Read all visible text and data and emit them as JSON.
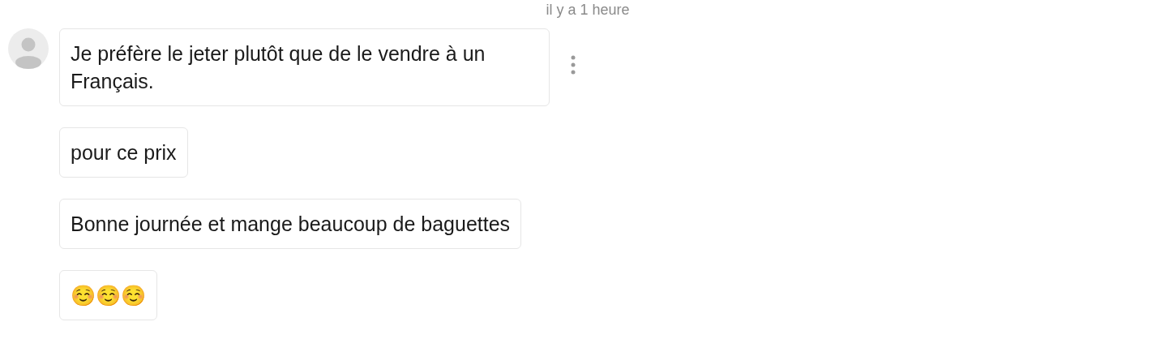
{
  "timestamp": "il y a 1 heure",
  "messages": [
    {
      "text": "Je préfère le jeter plutôt que de le vendre à un Français.",
      "menu": true
    },
    {
      "text": "pour ce prix",
      "menu": false
    },
    {
      "text": "Bonne journée et mange beaucoup de baguettes",
      "menu": false
    },
    {
      "text": "☺️☺️☺️",
      "menu": false
    }
  ]
}
